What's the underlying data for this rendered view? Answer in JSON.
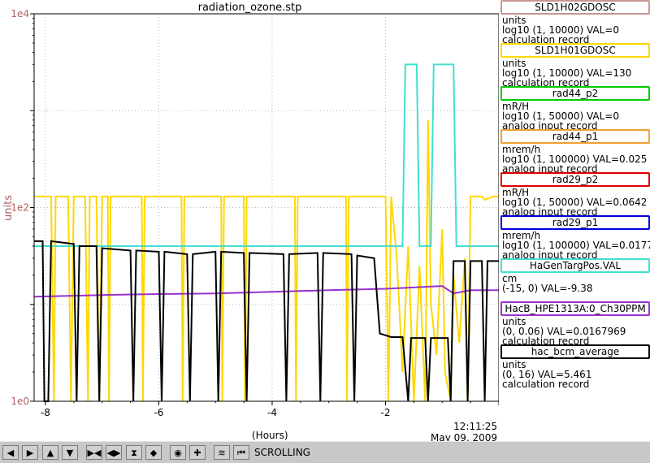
{
  "title": "radiation_ozone.stp",
  "ylabel": "units",
  "xlabel": "(Hours)",
  "x_end_time": "12:11:25",
  "x_end_date": "May 09, 2009",
  "toolbar": {
    "status": "SCROLLING",
    "buttons": [
      {
        "name": "scroll-left-button",
        "icon": "arrow-left-icon",
        "glyph": "◀"
      },
      {
        "name": "scroll-right-button",
        "icon": "arrow-right-icon",
        "glyph": "▶"
      },
      {
        "name": "scroll-up-button",
        "icon": "arrow-up-icon",
        "glyph": "▲"
      },
      {
        "name": "scroll-down-button",
        "icon": "arrow-down-icon",
        "glyph": "▼"
      },
      {
        "name": "zoom-in-x-button",
        "icon": "zoom-in-x-icon",
        "glyph": "▶◀"
      },
      {
        "name": "zoom-out-x-button",
        "icon": "zoom-out-x-icon",
        "glyph": "◀▶"
      },
      {
        "name": "zoom-in-y-button",
        "icon": "zoom-in-y-icon",
        "glyph": "⧗"
      },
      {
        "name": "zoom-out-y-button",
        "icon": "zoom-out-y-icon",
        "glyph": "◆"
      },
      {
        "name": "autoscale-button",
        "icon": "target-icon",
        "glyph": "◉"
      },
      {
        "name": "add-channel-button",
        "icon": "plus-icon",
        "glyph": "✚"
      },
      {
        "name": "stripchart-button",
        "icon": "waveform-icon",
        "glyph": "≋"
      },
      {
        "name": "jump-to-now-button",
        "icon": "jump-end-icon",
        "glyph": "⏮"
      }
    ]
  },
  "legend": [
    {
      "name": "SLD1H02GDOSC",
      "units": "units",
      "range": "log10 (1, 10000)  VAL=0",
      "rtype": "calculation record",
      "color": "#c89696"
    },
    {
      "name": "SLD1H01GDOSC",
      "units": "units",
      "range": "log10 (1, 10000) VAL=130",
      "rtype": "calculation record",
      "color": "#ffd700"
    },
    {
      "name": "rad44_p2",
      "units": "mR/H",
      "range": "log10 (1, 50000) VAL=0",
      "rtype": "analog input record",
      "color": "#00cc00"
    },
    {
      "name": "rad44_p1",
      "units": "mrem/h",
      "range": "log10 (1, 100000) VAL=0.025",
      "rtype": "analog input record",
      "color": "#f0a030"
    },
    {
      "name": "rad29_p2",
      "units": "mR/H",
      "range": "log10 (1, 50000) VAL=0.0642",
      "rtype": "analog input record",
      "color": "#e00000"
    },
    {
      "name": "rad29_p1",
      "units": "mrem/h",
      "range": "log10 (1, 100000) VAL=0.0177",
      "rtype": "analog input record",
      "color": "#0000dd"
    },
    {
      "name": "HaGenTargPos.VAL",
      "units": "cm",
      "range": "(-15, 0) VAL=-9.38",
      "rtype": "",
      "color": "#40e0d0"
    },
    {
      "name": "HacB_HPE1313A:0_Ch30PPM",
      "units": "units",
      "range": "(0, 0.06) VAL=0.0167969",
      "rtype": "calculation record",
      "color": "#9932cc"
    },
    {
      "name": "hac_bcm_average",
      "units": "units",
      "range": "(0, 16) VAL=5.461",
      "rtype": "calculation record",
      "color": "#000000"
    }
  ],
  "chart_data": {
    "type": "line",
    "title": "radiation_ozone.stp",
    "xlabel": "(Hours)",
    "ylabel": "units",
    "yscale": "log10",
    "ylim": [
      1,
      10000
    ],
    "xlim": [
      -8.2,
      0
    ],
    "xticks": [
      -8,
      -6,
      -4,
      -2
    ],
    "ytick_labels": [
      "1e0",
      "1e2",
      "1e4"
    ],
    "grid": true,
    "series": [
      {
        "name": "SLD1H01GDOSC",
        "color": "#ffd700",
        "points": [
          [
            -8.2,
            130
          ],
          [
            -8.0,
            130
          ],
          [
            -7.9,
            130
          ],
          [
            -7.85,
            1
          ],
          [
            -7.82,
            130
          ],
          [
            -7.6,
            130
          ],
          [
            -7.55,
            1
          ],
          [
            -7.5,
            130
          ],
          [
            -7.3,
            130
          ],
          [
            -7.25,
            1
          ],
          [
            -7.22,
            130
          ],
          [
            -7.1,
            130
          ],
          [
            -7.05,
            1
          ],
          [
            -7.0,
            130
          ],
          [
            -6.9,
            130
          ],
          [
            -6.88,
            1
          ],
          [
            -6.85,
            130
          ],
          [
            -6.3,
            130
          ],
          [
            -6.28,
            1
          ],
          [
            -6.25,
            130
          ],
          [
            -5.6,
            130
          ],
          [
            -5.58,
            1
          ],
          [
            -5.55,
            130
          ],
          [
            -4.9,
            130
          ],
          [
            -4.88,
            1
          ],
          [
            -4.85,
            130
          ],
          [
            -4.5,
            130
          ],
          [
            -4.48,
            1
          ],
          [
            -4.45,
            130
          ],
          [
            -3.6,
            130
          ],
          [
            -3.58,
            1
          ],
          [
            -3.55,
            130
          ],
          [
            -2.7,
            130
          ],
          [
            -2.68,
            1
          ],
          [
            -2.65,
            130
          ],
          [
            -2.2,
            130
          ],
          [
            -2.0,
            130
          ],
          [
            -1.95,
            1
          ],
          [
            -1.9,
            130
          ],
          [
            -1.8,
            30
          ],
          [
            -1.7,
            2
          ],
          [
            -1.6,
            40
          ],
          [
            -1.5,
            1
          ],
          [
            -1.4,
            25
          ],
          [
            -1.3,
            1
          ],
          [
            -1.25,
            800
          ],
          [
            -1.2,
            10
          ],
          [
            -1.1,
            3
          ],
          [
            -1.0,
            60
          ],
          [
            -0.95,
            2
          ],
          [
            -0.85,
            1
          ],
          [
            -0.8,
            20
          ],
          [
            -0.7,
            4
          ],
          [
            -0.6,
            30
          ],
          [
            -0.55,
            1
          ],
          [
            -0.5,
            130
          ],
          [
            -0.3,
            130
          ],
          [
            -0.25,
            120
          ],
          [
            -0.1,
            130
          ],
          [
            0,
            130
          ]
        ]
      },
      {
        "name": "HaGenTargPos.VAL",
        "color": "#40e0d0",
        "points": [
          [
            -8.2,
            40
          ],
          [
            -1.7,
            40
          ],
          [
            -1.65,
            3000
          ],
          [
            -1.45,
            3000
          ],
          [
            -1.4,
            40
          ],
          [
            -1.2,
            40
          ],
          [
            -1.15,
            3000
          ],
          [
            -0.8,
            3000
          ],
          [
            -0.75,
            40
          ],
          [
            0,
            40
          ]
        ]
      },
      {
        "name": "HacB_HPE1313A:0_Ch30PPM",
        "color": "#9932cc",
        "points": [
          [
            -8.2,
            12
          ],
          [
            -7.0,
            12.5
          ],
          [
            -6.0,
            12.8
          ],
          [
            -5.0,
            13
          ],
          [
            -4.0,
            13.5
          ],
          [
            -3.0,
            14
          ],
          [
            -2.0,
            14.5
          ],
          [
            -1.0,
            15.5
          ],
          [
            -0.8,
            13
          ],
          [
            -0.5,
            14
          ],
          [
            0,
            14
          ]
        ]
      },
      {
        "name": "hac_bcm_average",
        "color": "#000000",
        "points": [
          [
            -8.2,
            45
          ],
          [
            -8.05,
            45
          ],
          [
            -8.02,
            1
          ],
          [
            -7.95,
            1
          ],
          [
            -7.9,
            45
          ],
          [
            -7.5,
            42
          ],
          [
            -7.45,
            1
          ],
          [
            -7.4,
            40
          ],
          [
            -7.1,
            40
          ],
          [
            -7.05,
            1
          ],
          [
            -7.0,
            38
          ],
          [
            -6.5,
            36
          ],
          [
            -6.45,
            1
          ],
          [
            -6.4,
            36
          ],
          [
            -6.0,
            35
          ],
          [
            -5.95,
            1
          ],
          [
            -5.9,
            35
          ],
          [
            -5.5,
            33
          ],
          [
            -5.45,
            1
          ],
          [
            -5.4,
            33
          ],
          [
            -5.0,
            35
          ],
          [
            -4.95,
            1
          ],
          [
            -4.9,
            35
          ],
          [
            -4.5,
            34
          ],
          [
            -4.45,
            1
          ],
          [
            -4.4,
            34
          ],
          [
            -3.8,
            33
          ],
          [
            -3.75,
            1
          ],
          [
            -3.7,
            33
          ],
          [
            -3.2,
            34
          ],
          [
            -3.15,
            1
          ],
          [
            -3.1,
            34
          ],
          [
            -2.6,
            33
          ],
          [
            -2.55,
            1
          ],
          [
            -2.5,
            32
          ],
          [
            -2.2,
            30
          ],
          [
            -2.1,
            5
          ],
          [
            -1.9,
            4.6
          ],
          [
            -1.7,
            4.6
          ],
          [
            -1.6,
            1
          ],
          [
            -1.55,
            4.5
          ],
          [
            -1.3,
            4.5
          ],
          [
            -1.25,
            1
          ],
          [
            -1.2,
            4.5
          ],
          [
            -0.9,
            4.5
          ],
          [
            -0.85,
            1
          ],
          [
            -0.8,
            28
          ],
          [
            -0.6,
            28
          ],
          [
            -0.55,
            1
          ],
          [
            -0.5,
            28
          ],
          [
            -0.3,
            28
          ],
          [
            -0.25,
            1
          ],
          [
            -0.2,
            28
          ],
          [
            0,
            28
          ]
        ]
      }
    ]
  }
}
